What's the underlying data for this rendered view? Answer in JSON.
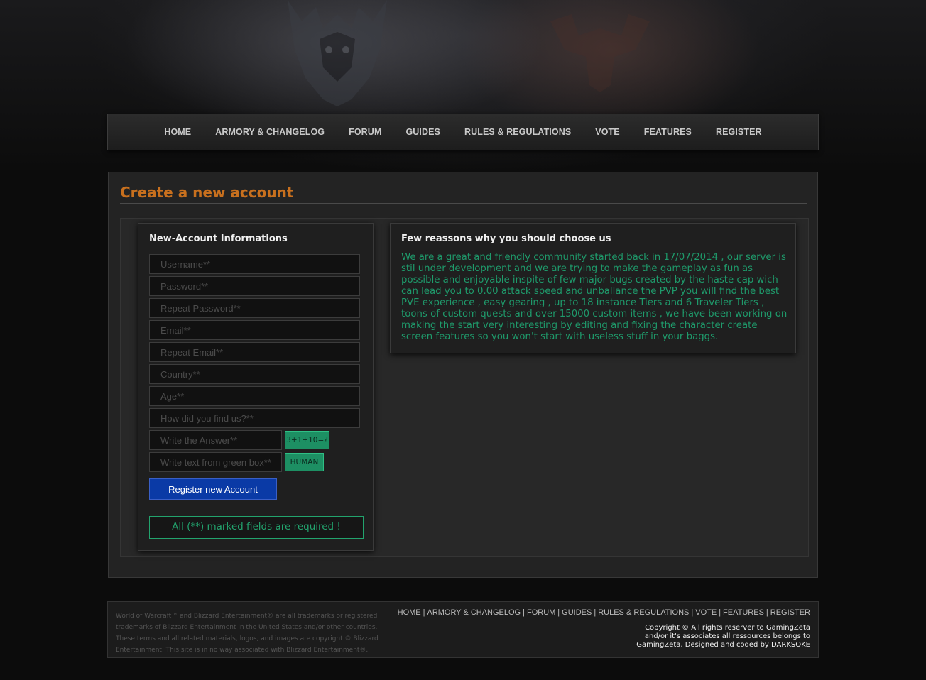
{
  "nav": {
    "items": [
      "HOME",
      "ARMORY & CHANGELOG",
      "FORUM",
      "GUIDES",
      "RULES & REGULATIONS",
      "VOTE",
      "FEATURES",
      "REGISTER"
    ]
  },
  "page": {
    "title": "Create a new account"
  },
  "form": {
    "title": "New-Account Informations",
    "fields": {
      "username": "Username**",
      "password": "Password**",
      "repeat_password": "Repeat Password**",
      "email": "Email**",
      "repeat_email": "Repeat Email**",
      "country": "Country**",
      "age": "Age**",
      "find_us": "How did you find us?**",
      "answer": "Write the Answer**",
      "green_text": "Write text from green box**"
    },
    "captcha_question": "3+1+10=?",
    "captcha_word": "HUMAN",
    "submit_label": "Register new Account",
    "required_note": "All (**) marked fields are required !"
  },
  "reasons": {
    "title": "Few reassons why you should choose us",
    "text": "We are a great and friendly community started back in 17/07/2014 , our server is stil under development and we are trying to make the gameplay as fun as possible and enjoyable inspite of few major bugs created by the haste cap wich can lead you to 0.00 attack speed and unballance the PVP you will find the best PVE experience , easy gearing , up to 18 instance Tiers and 6 Traveler Tiers , toons of custom quests and over 15000 custom items , we have been working on making the start very interesting by editing and fixing the character create screen features so you won't start with useless stuff in your baggs."
  },
  "footer": {
    "legal": "World of Warcraft™ and Blizzard Entertainment® are all trademarks or registered trademarks of Blizzard Entertainment in the United States and/or other countries. These terms and all related materials, logos, and images are copyright © Blizzard Entertainment. This site is in no way associated with Blizzard Entertainment®.",
    "nav": [
      "HOME",
      "ARMORY & CHANGELOG",
      "FORUM",
      "GUIDES",
      "RULES & REGULATIONS",
      "VOTE",
      "FEATURES",
      "REGISTER"
    ],
    "separator": "|",
    "copyright": "Copyright © All rights reserver to GamingZeta and/or it's associates all ressources belongs to GamingZeta, Designed and coded by DARKSOKE"
  },
  "colors": {
    "title_orange": "#c8701e",
    "accent_green": "#1f9a6b",
    "button_blue": "#0a3aa6"
  },
  "icons": {
    "alliance": "alliance-emblem-icon",
    "horde": "horde-emblem-icon"
  }
}
